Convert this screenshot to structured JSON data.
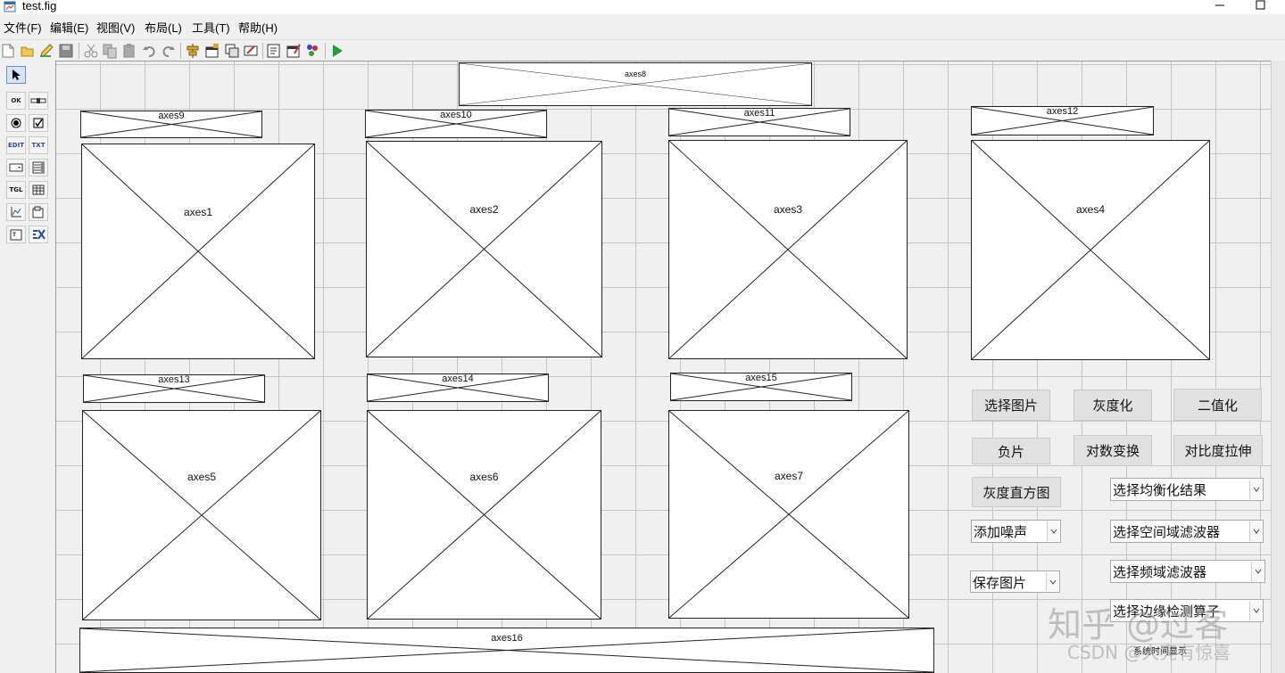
{
  "window": {
    "title": "test.fig"
  },
  "menu": [
    "文件(F)",
    "编辑(E)",
    "视图(V)",
    "布局(L)",
    "工具(T)",
    "帮助(H)"
  ],
  "toolbar": {
    "icons": [
      "new-icon",
      "open-icon",
      "edit-icon",
      "save-icon",
      "cut-icon",
      "copy-icon",
      "paste-icon",
      "undo-icon",
      "redo-icon",
      "align-icon",
      "menu-editor-icon",
      "tab-order-icon",
      "toolbar-editor-icon",
      "editor-icon",
      "property-inspector-icon",
      "object-browser-icon",
      "run-icon"
    ]
  },
  "palette": {
    "items": [
      {
        "name": "select-tool",
        "text": ""
      },
      {
        "name": "push-button-tool",
        "text": "OK"
      },
      {
        "name": "slider-tool",
        "text": ""
      },
      {
        "name": "radio-button-tool",
        "text": ""
      },
      {
        "name": "checkbox-tool",
        "text": ""
      },
      {
        "name": "edit-text-tool",
        "text": "EDIT"
      },
      {
        "name": "static-text-tool",
        "text": "TXT"
      },
      {
        "name": "popup-menu-tool",
        "text": ""
      },
      {
        "name": "listbox-tool",
        "text": ""
      },
      {
        "name": "toggle-button-tool",
        "text": "TGL"
      },
      {
        "name": "table-tool",
        "text": ""
      },
      {
        "name": "axes-tool",
        "text": ""
      },
      {
        "name": "panel-tool",
        "text": ""
      },
      {
        "name": "button-group-tool",
        "text": ""
      },
      {
        "name": "activex-tool",
        "text": ""
      }
    ]
  },
  "axes": {
    "axes8": "axes8",
    "axes9": "axes9",
    "axes10": "axes10",
    "axes11": "axes11",
    "axes12": "axes12",
    "axes1": "axes1",
    "axes2": "axes2",
    "axes3": "axes3",
    "axes4": "axes4",
    "axes13": "axes13",
    "axes14": "axes14",
    "axes15": "axes15",
    "axes5": "axes5",
    "axes6": "axes6",
    "axes7": "axes7",
    "axes16": "axes16"
  },
  "buttons": {
    "select_image": "选择图片",
    "grayscale": "灰度化",
    "binarize": "二值化",
    "negative": "负片",
    "log_transform": "对数变换",
    "contrast_stretch": "对比度拉伸",
    "gray_histogram": "灰度直方图"
  },
  "popups": {
    "equalize_result": "选择均衡化结果",
    "add_noise": "添加噪声",
    "spatial_filter": "选择空间域滤波器",
    "freq_filter": "选择频域滤波器",
    "save_image": "保存图片",
    "edge_operator": "选择边缘检测算子"
  },
  "static_text": {
    "system_time": "系统时间显示"
  },
  "watermark": {
    "zhihu": "知乎 @过客",
    "csdn": "CSDN @大亮有惊喜"
  }
}
